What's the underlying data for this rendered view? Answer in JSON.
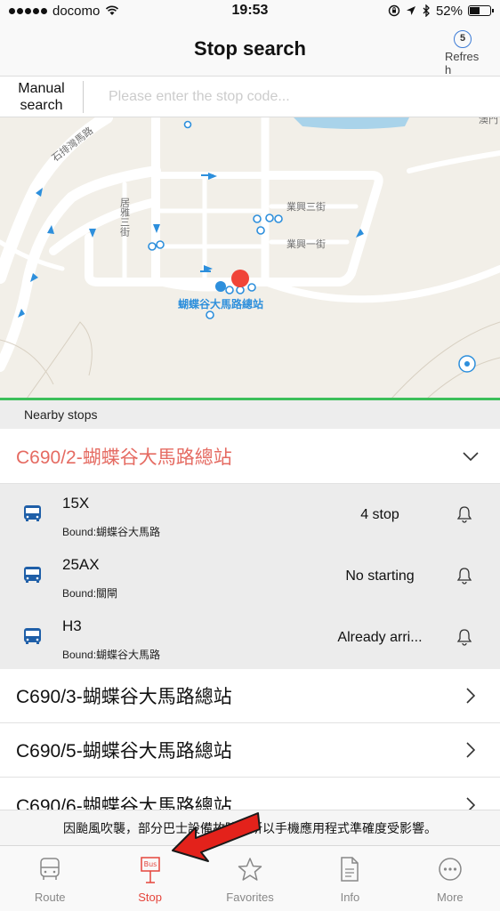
{
  "status_bar": {
    "carrier": "docomo",
    "time": "19:53",
    "battery": "52%",
    "battery_level": 0.52,
    "icons": [
      "signal-dots-icon",
      "wifi-icon",
      "lock-rotation-icon",
      "location-arrow-icon",
      "bluetooth-icon",
      "battery-icon"
    ]
  },
  "nav": {
    "title": "Stop search",
    "refresh_count": "5",
    "refresh_label": "Refresh"
  },
  "search": {
    "manual_label": "Manual search",
    "placeholder": "Please enter the stop code..."
  },
  "map": {
    "street_labels": [
      "石排灣馬路",
      "居雅三街",
      "業興三街",
      "業興一街"
    ],
    "station_label": "蝴蝶谷大馬路總站",
    "edge_label": "澳門"
  },
  "nearby": {
    "header": "Nearby stops",
    "groups": [
      {
        "title": "C690/2-蝴蝶谷大馬路總站",
        "expanded": true
      },
      {
        "title": "C690/3-蝴蝶谷大馬路總站",
        "expanded": false
      },
      {
        "title": "C690/5-蝴蝶谷大馬路總站",
        "expanded": false
      },
      {
        "title": "C690/6-蝴蝶谷大馬路總站",
        "expanded": false
      }
    ],
    "routes": [
      {
        "number": "15X",
        "bound": "Bound:蝴蝶谷大馬路",
        "status": "4 stop"
      },
      {
        "number": "25AX",
        "bound": "Bound:關閘",
        "status": "No starting"
      },
      {
        "number": "H3",
        "bound": "Bound:蝴蝶谷大馬路",
        "status": "Already arri..."
      }
    ]
  },
  "notice": "因颱風吹襲，部分巴士設備故障，所以手機應用程式準確度受影響。",
  "tabs": [
    {
      "label": "Route",
      "icon": "bus-icon",
      "active": false
    },
    {
      "label": "Stop",
      "icon": "bus-stop-sign-icon",
      "active": true,
      "badge": "Bus"
    },
    {
      "label": "Favorites",
      "icon": "star-icon",
      "active": false
    },
    {
      "label": "Info",
      "icon": "document-icon",
      "active": false
    },
    {
      "label": "More",
      "icon": "ellipsis-circle-icon",
      "active": false
    }
  ],
  "colors": {
    "accent_red": "#e56b62",
    "active_tab": "#e5453c",
    "map_green_line": "#3cbf5a",
    "bus_blue": "#1f5fa8",
    "arrow_red": "#e3221b"
  }
}
